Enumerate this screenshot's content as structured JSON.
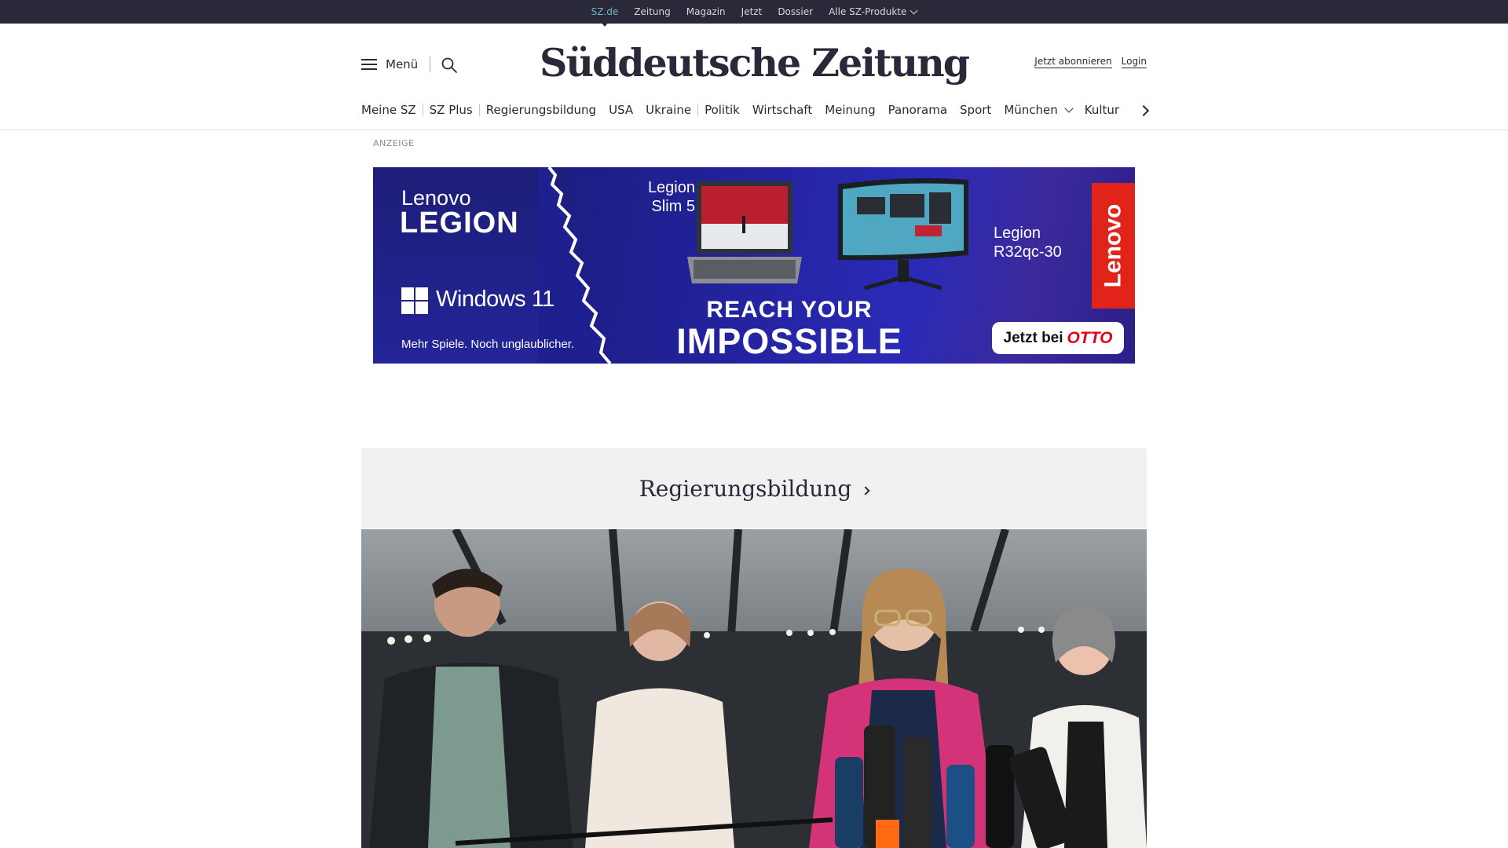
{
  "topbar": {
    "items": [
      {
        "label": "SZ.de",
        "active": true
      },
      {
        "label": "Zeitung"
      },
      {
        "label": "Magazin"
      },
      {
        "label": "Jetzt"
      },
      {
        "label": "Dossier"
      },
      {
        "label": "Alle SZ-Produkte",
        "icon": "chevron-down-icon"
      }
    ]
  },
  "header": {
    "menu_label": "Menü",
    "logo": "Süddeutsche Zeitung",
    "subscribe_label": "Jetzt abonnieren",
    "login_label": "Login"
  },
  "section_nav": {
    "items": [
      {
        "label": "Meine SZ"
      },
      {
        "label": "SZ Plus"
      },
      {
        "label": "Regierungsbildung"
      },
      {
        "label": "USA"
      },
      {
        "label": "Ukraine"
      },
      {
        "label": "Politik"
      },
      {
        "label": "Wirtschaft"
      },
      {
        "label": "Meinung"
      },
      {
        "label": "Panorama"
      },
      {
        "label": "Sport"
      },
      {
        "label": "München",
        "icon": "chevron-down-icon"
      },
      {
        "label": "Kultur"
      }
    ]
  },
  "ad": {
    "label": "ANZEIGE",
    "brand_small": "Lenovo",
    "brand_big": "LEGION",
    "os": "Windows 11",
    "tagline": "Mehr Spiele. Noch unglaublicher.",
    "product1_line1": "Legion",
    "product1_line2": "Slim 5",
    "product2_line1": "Legion",
    "product2_line2": "R32qc-30",
    "badge": "Lenovo",
    "headline1": "REACH YOUR",
    "headline2": "IMPOSSIBLE",
    "cta": "Jetzt bei",
    "cta_brand": "OTTO"
  },
  "section_teaser": {
    "title": "Regierungsbildung"
  },
  "colors": {
    "ink": "#29293a",
    "topbar_bg": "#29293a",
    "topbar_active": "#71b6c8",
    "teaser_bg": "#f1f1f1",
    "otto_red": "#e2001a",
    "lenovo_red": "#e2231a"
  }
}
